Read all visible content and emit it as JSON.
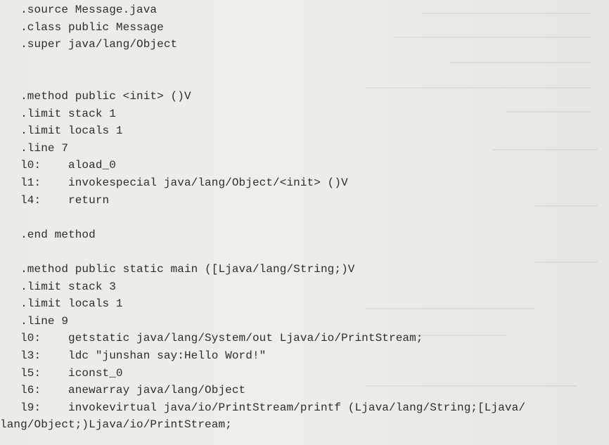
{
  "document": {
    "code_lines": [
      "   .source Message.java",
      "   .class public Message",
      "   .super java/lang/Object",
      "",
      "",
      "   .method public <init> ()V",
      "   .limit stack 1",
      "   .limit locals 1",
      "   .line 7",
      "   l0:    aload_0",
      "   l1:    invokespecial java/lang/Object/<init> ()V",
      "   l4:    return",
      "",
      "   .end method",
      "",
      "   .method public static main ([Ljava/lang/String;)V",
      "   .limit stack 3",
      "   .limit locals 1",
      "   .line 9",
      "   l0:    getstatic java/lang/System/out Ljava/io/PrintStream;",
      "   l3:    ldc \"junshan say:Hello Word!\"",
      "   l5:    iconst_0",
      "   l6:    anewarray java/lang/Object",
      "   l9:    invokevirtual java/io/PrintStream/printf (Ljava/lang/String;[Ljava/",
      "lang/Object;)Ljava/io/PrintStream;"
    ]
  }
}
